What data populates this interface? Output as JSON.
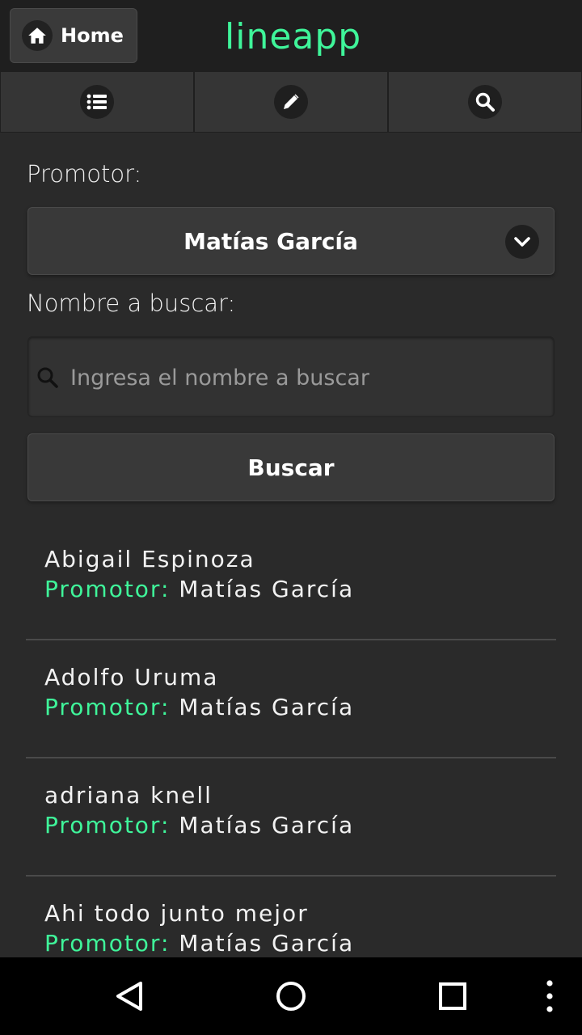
{
  "header": {
    "home_label": "Home",
    "brand": "lineapp",
    "brand_color": "#3ff59a"
  },
  "navbar": {
    "items": [
      {
        "icon": "list-icon"
      },
      {
        "icon": "pencil-icon"
      },
      {
        "icon": "search-icon"
      }
    ]
  },
  "form": {
    "promoter_label": "Promotor:",
    "promoter_selected": "Matías García",
    "search_label": "Nombre a buscar:",
    "search_placeholder": "Ingresa el nombre a buscar",
    "search_value": "",
    "submit_label": "Buscar"
  },
  "results": [
    {
      "name": "Abigail Espinoza",
      "key": "Promotor:",
      "value": "Matías García"
    },
    {
      "name": "Adolfo Uruma",
      "key": "Promotor:",
      "value": "Matías García"
    },
    {
      "name": "adriana knell",
      "key": "Promotor:",
      "value": "Matías García"
    },
    {
      "name": "Ahi todo junto mejor",
      "key": "Promotor:",
      "value": "Matías García"
    }
  ],
  "system_nav": {
    "items": [
      "back-icon",
      "home-circle-icon",
      "recents-icon",
      "overflow-menu-icon"
    ]
  }
}
